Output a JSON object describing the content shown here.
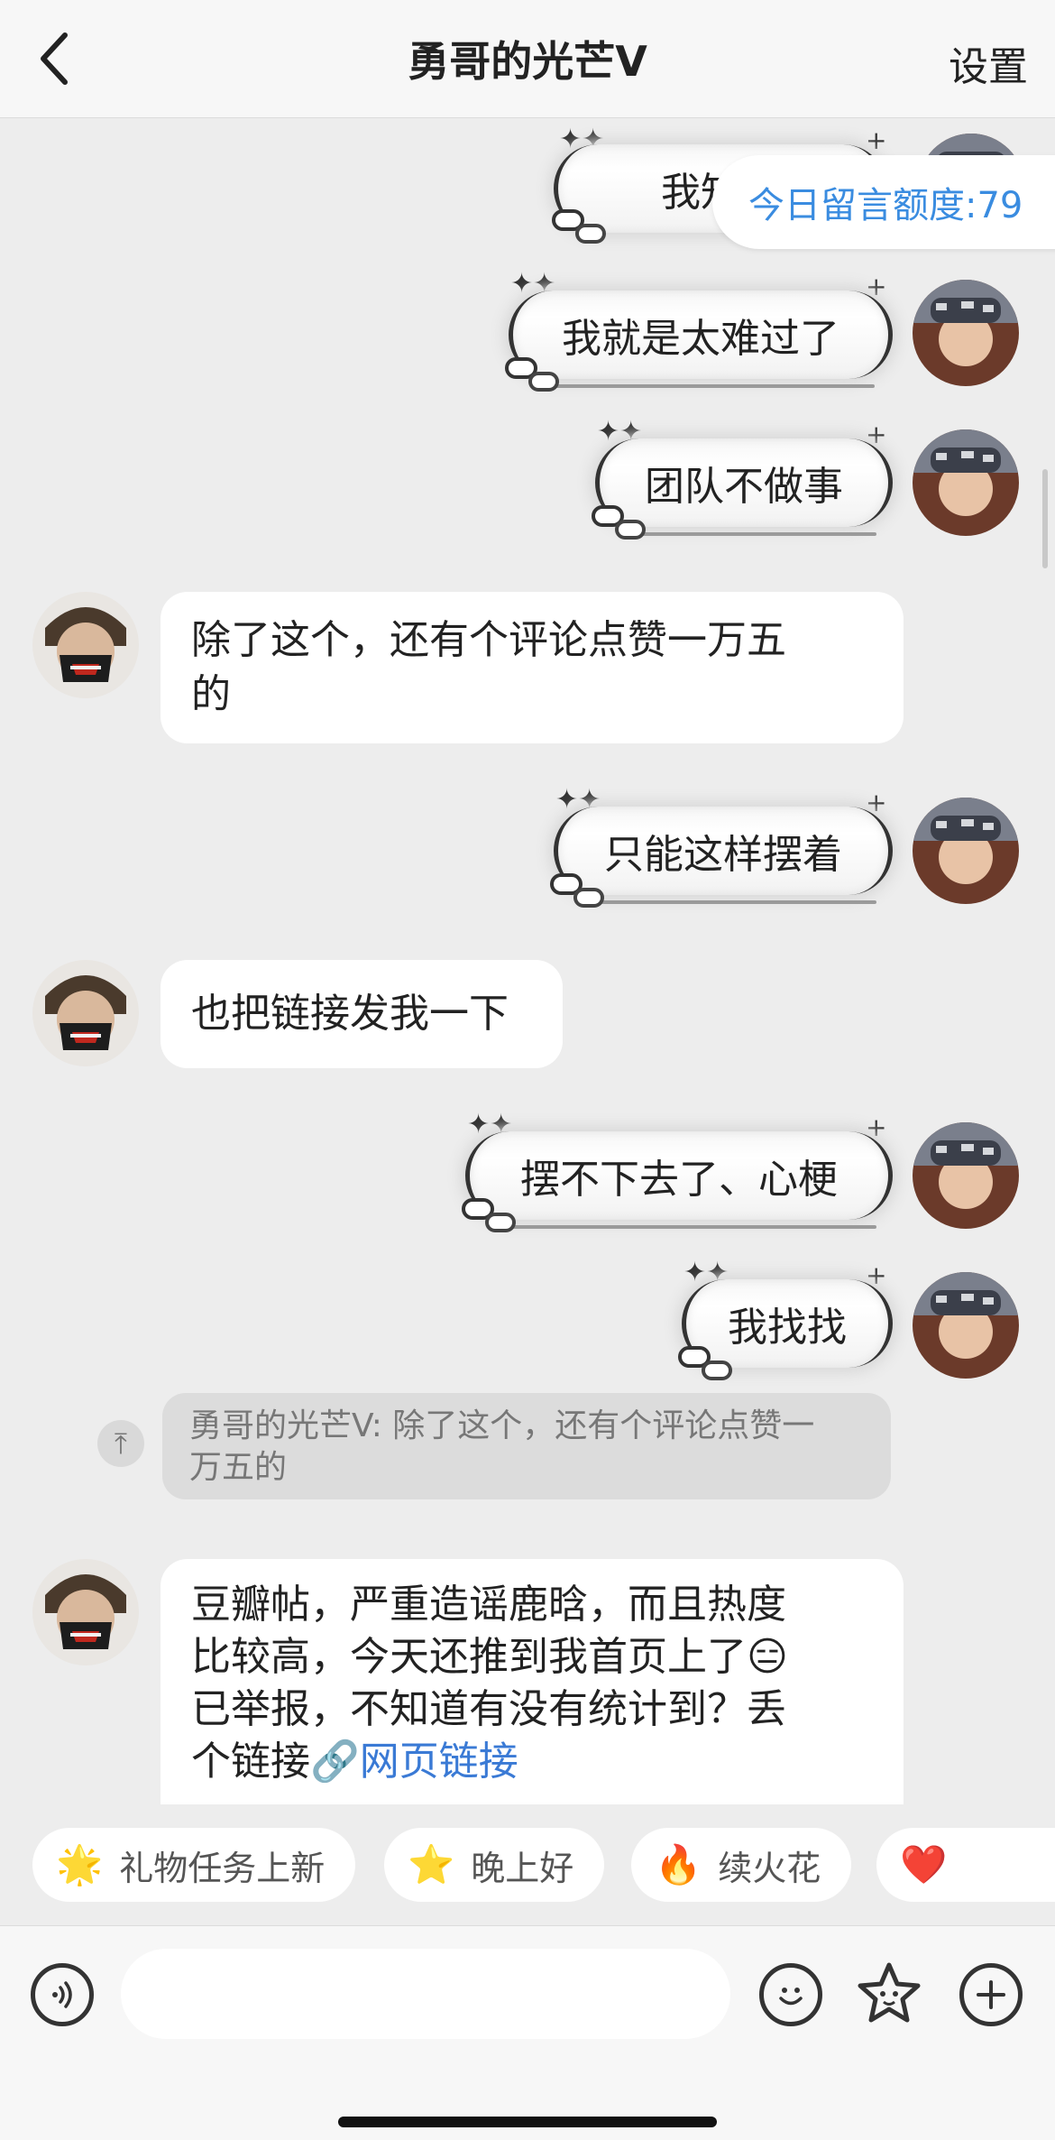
{
  "header": {
    "back_icon": "chevron-left-icon",
    "title": "勇哥的光芒Ⅴ",
    "settings_label": "设置"
  },
  "quota": {
    "label": "今日留言额度:79"
  },
  "messages": [
    {
      "side": "sent",
      "text": "我知道"
    },
    {
      "side": "sent",
      "text": "我就是太难过了"
    },
    {
      "side": "sent",
      "text": "团队不做事"
    },
    {
      "side": "received",
      "text_line1": "除了这个，还有个评论点赞一万五",
      "text_line2": "的"
    },
    {
      "side": "sent",
      "text": "只能这样摆着"
    },
    {
      "side": "received",
      "text": "也把链接发我一下"
    },
    {
      "side": "sent",
      "text": "摆不下去了、心梗"
    },
    {
      "side": "sent",
      "text": "我找找"
    }
  ],
  "quote": {
    "line1": "勇哥的光芒V: 除了这个，还有个评论点赞一",
    "line2": "万五的"
  },
  "last_message": {
    "line1": "豆瓣帖，严重造谣鹿晗，而且热度",
    "line2": "比较高，今天还推到我首页上了",
    "line3": "已举报，不知道有没有统计到？丢",
    "line4": "个链接",
    "link_label": "网页链接",
    "emoji": "😑"
  },
  "quick_replies": [
    {
      "emoji": "🌟",
      "label": "礼物任务上新"
    },
    {
      "emoji": "⭐",
      "label": "晚上好"
    },
    {
      "emoji": "🔥",
      "label": "续火花"
    },
    {
      "emoji": "❤️",
      "label": ""
    }
  ],
  "input_bar": {
    "voice_icon": "voice-icon",
    "emoji_icon": "smiley-icon",
    "sticker_icon": "star-face-icon",
    "plus_icon": "plus-icon"
  },
  "colors": {
    "accent": "#3a8ce0",
    "background": "#ededed"
  }
}
